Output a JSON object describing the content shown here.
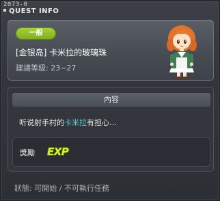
{
  "window": {
    "quest_id": "2073-0",
    "title": "QUEST INFO"
  },
  "quest": {
    "category_badge": "一般",
    "name": "[金银岛] 卡米拉的玻璃珠",
    "level_requirement": "建議等級: 23~27",
    "npc_icon": "npc-girl-portrait"
  },
  "content": {
    "header": "內容",
    "text_before": "听说射手村的",
    "text_highlight": "卡米拉",
    "text_after": "有担心…",
    "highlight_color": "#5ad2d6"
  },
  "reward": {
    "label": "獎勵",
    "icon": "exp-icon",
    "icon_text": "EXP"
  },
  "status": {
    "text": "狀態: 可開始 / 不可執行任務"
  },
  "colors": {
    "badge": "#8fbf2a",
    "exp": "#d8f23a"
  }
}
